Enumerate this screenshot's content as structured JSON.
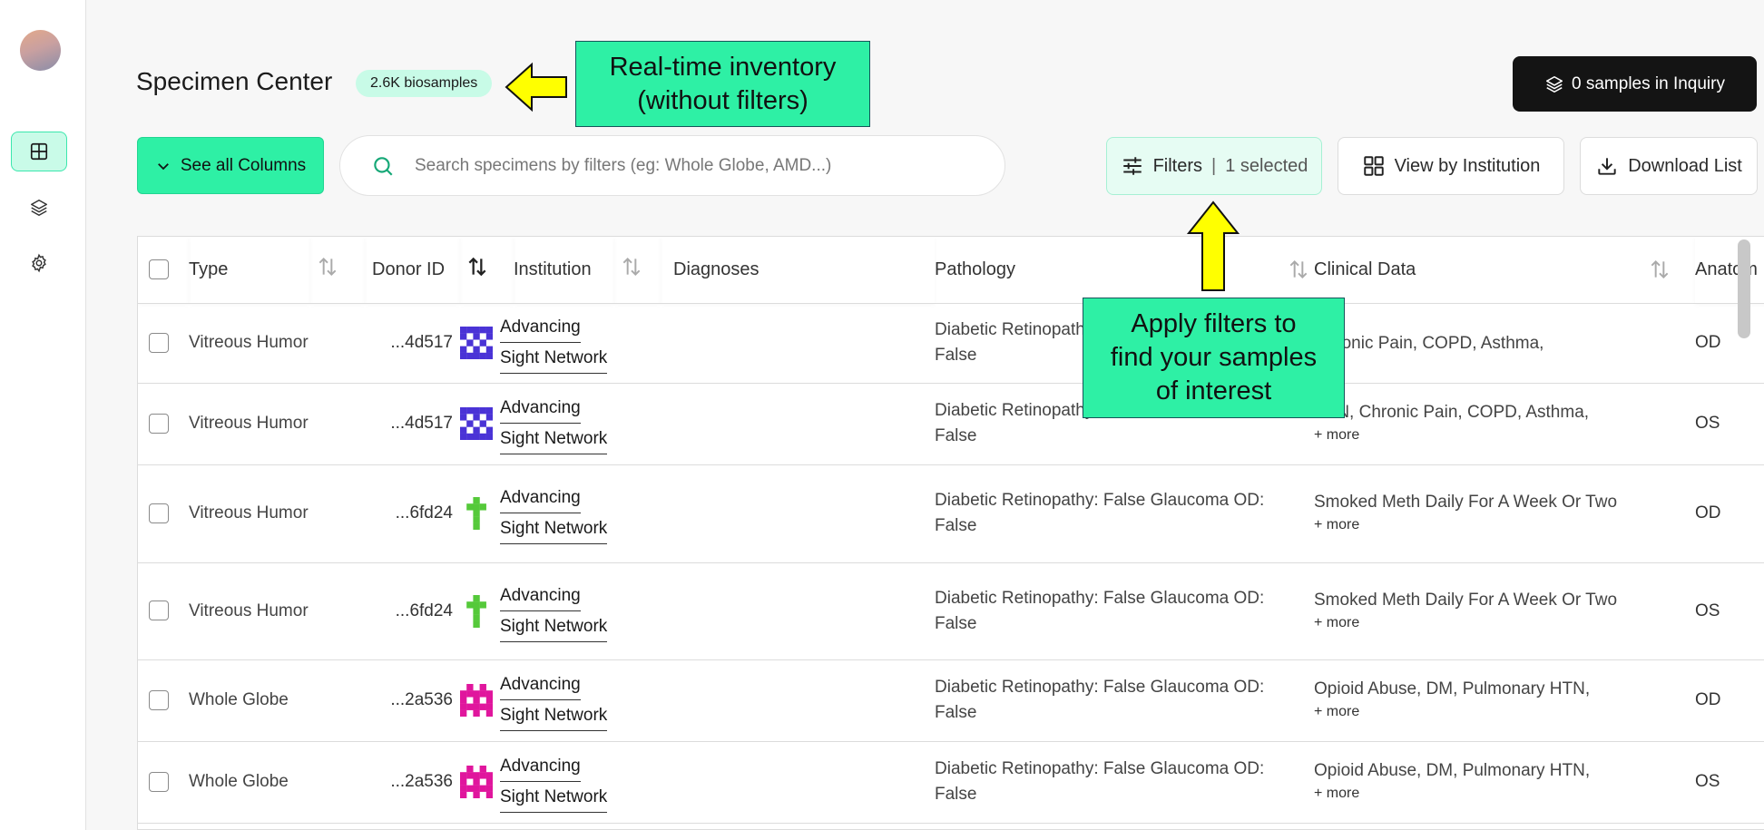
{
  "page": {
    "title": "Specimen Center",
    "biosample_badge": "2.6K biosamples"
  },
  "toolbar": {
    "inquiry_label": "0 samples in Inquiry",
    "columns_label": "See all Columns",
    "search_placeholder": "Search specimens by filters (eg: Whole Globe, AMD...)",
    "filters_label": "Filters",
    "filters_separator": "|",
    "filters_selected": "1 selected",
    "view_by_label": "View by Institution",
    "download_label": "Download List"
  },
  "table": {
    "headers": {
      "type": "Type",
      "donor_id": "Donor ID",
      "institution": "Institution",
      "diagnoses": "Diagnoses",
      "pathology": "Pathology",
      "clinical_data": "Clinical Data",
      "anatomy": "Anatom"
    },
    "rows": [
      {
        "type": "Vitreous Humor",
        "donor": "...4d517",
        "identicon_color": "#4a33d6",
        "inst_line1": "Advancing",
        "inst_line2": "Sight Network",
        "diagnoses": "",
        "path_line1": "Diabetic Retinopathy",
        "path_line2": "False",
        "clin_line1": "Chronic Pain, COPD, Asthma,",
        "clin_more": "",
        "anat": "OD"
      },
      {
        "type": "Vitreous Humor",
        "donor": "...4d517",
        "identicon_color": "#4a33d6",
        "inst_line1": "Advancing",
        "inst_line2": "Sight Network",
        "diagnoses": "",
        "path_line1": "Diabetic Retinopathy",
        "path_line2": "False",
        "clin_line1": "HTN, Chronic Pain, COPD, Asthma,",
        "clin_more": "+ more",
        "anat": "OS"
      },
      {
        "type": "Vitreous Humor",
        "donor": "...6fd24",
        "identicon_color": "#55c93a",
        "inst_line1": "Advancing",
        "inst_line2": "Sight Network",
        "diagnoses": "",
        "path_line1": "Diabetic Retinopathy: False Glaucoma OD:",
        "path_line2": "False",
        "clin_line1": "Smoked Meth Daily For A Week Or Two",
        "clin_more": "+ more",
        "anat": "OD"
      },
      {
        "type": "Vitreous Humor",
        "donor": "...6fd24",
        "identicon_color": "#55c93a",
        "inst_line1": "Advancing",
        "inst_line2": "Sight Network",
        "diagnoses": "",
        "path_line1": "Diabetic Retinopathy: False Glaucoma OD:",
        "path_line2": "False",
        "clin_line1": "Smoked Meth Daily For A Week Or Two",
        "clin_more": "+ more",
        "anat": "OS"
      },
      {
        "type": "Whole Globe",
        "donor": "...2a536",
        "identicon_color": "#e0169d",
        "inst_line1": "Advancing",
        "inst_line2": "Sight Network",
        "diagnoses": "",
        "path_line1": "Diabetic Retinopathy: False Glaucoma OD:",
        "path_line2": "False",
        "clin_line1": "Opioid Abuse, DM, Pulmonary HTN,",
        "clin_more": "+ more",
        "anat": "OD"
      },
      {
        "type": "Whole Globe",
        "donor": "...2a536",
        "identicon_color": "#e0169d",
        "inst_line1": "Advancing",
        "inst_line2": "Sight Network",
        "diagnoses": "",
        "path_line1": "Diabetic Retinopathy: False Glaucoma OD:",
        "path_line2": "False",
        "clin_line1": "Opioid Abuse, DM, Pulmonary HTN,",
        "clin_more": "+ more",
        "anat": "OS"
      }
    ]
  },
  "annotations": {
    "callout_inventory_line1": "Real-time inventory",
    "callout_inventory_line2": "(without filters)",
    "callout_filters_line1": "Apply filters to",
    "callout_filters_line2": "find your samples",
    "callout_filters_line3": "of interest"
  },
  "colors": {
    "accent": "#2ef0a5",
    "badge_bg": "#c8fbe7",
    "dark_button": "#141414",
    "arrow_yellow": "#ffff00"
  },
  "icons": {
    "sidebar": [
      "grid-icon",
      "layers-icon",
      "gear-icon"
    ],
    "toolbar": [
      "layers-icon",
      "chevron-down-icon",
      "search-icon",
      "sliders-icon",
      "grid-four-icon",
      "download-icon"
    ]
  }
}
